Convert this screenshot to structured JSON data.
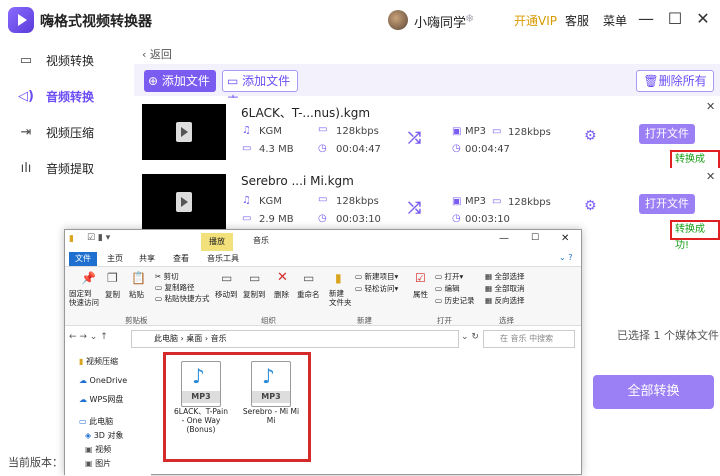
{
  "app": {
    "title": "嗨格式视频转换器",
    "username": "小嗨同学",
    "vip": "开通VIP",
    "service": "客服",
    "menu": "菜单"
  },
  "sidebar": {
    "items": [
      {
        "label": "视频转换",
        "icon": "film-icon"
      },
      {
        "label": "音频转换",
        "icon": "audio-icon"
      },
      {
        "label": "视频压缩",
        "icon": "compress-icon"
      },
      {
        "label": "音频提取",
        "icon": "waveform-icon"
      }
    ]
  },
  "toolbar": {
    "back": "返回",
    "add_file": "添加文件",
    "add_folder": "添加文件夹",
    "delete_all": "删除所有"
  },
  "files": [
    {
      "name": "6LACK、T-...nus).kgm",
      "src_format": "KGM",
      "src_bitrate": "128kbps",
      "src_size": "4.3 MB",
      "src_duration": "00:04:47",
      "dst_format": "MP3",
      "dst_bitrate": "128kbps",
      "dst_duration": "00:04:47",
      "open_label": "打开文件",
      "status": "转换成功!"
    },
    {
      "name": "Serebro ...i Mi.kgm",
      "src_format": "KGM",
      "src_bitrate": "128kbps",
      "src_size": "2.9 MB",
      "src_duration": "00:03:10",
      "dst_format": "MP3",
      "dst_bitrate": "128kbps",
      "dst_duration": "00:03:10",
      "open_label": "打开文件",
      "status": "转换成功!"
    }
  ],
  "footer": {
    "selected": "已选择 1 个媒体文件",
    "convert_all": "全部转换",
    "version": "当前版本：1"
  },
  "explorer": {
    "title": "音乐",
    "tabs": {
      "file": "文件",
      "home": "主页",
      "share": "共享",
      "view": "查看",
      "music_tools": "音乐工具",
      "play": "播放"
    },
    "ribbon": {
      "pin": "固定到\n快速访问",
      "copy": "复制",
      "paste": "粘贴",
      "cut": "剪切",
      "copy_path": "复制路径",
      "paste_shortcut": "粘贴快捷方式",
      "move_to": "移动到",
      "copy_to": "复制到",
      "delete": "删除",
      "rename": "重命名",
      "new_folder": "新建\n文件夹",
      "new_item": "新建项目",
      "easy_access": "轻松访问",
      "properties": "属性",
      "open": "打开",
      "edit": "编辑",
      "history": "历史记录",
      "select_all": "全部选择",
      "select_none": "全部取消",
      "invert": "反向选择",
      "g_clipboard": "剪贴板",
      "g_organize": "组织",
      "g_new": "新建",
      "g_open": "打开",
      "g_select": "选择"
    },
    "path": [
      "此电脑",
      "桌面",
      "音乐"
    ],
    "search_placeholder": "在 音乐 中搜索",
    "nav": [
      "视频压缩",
      "OneDrive",
      "WPS网盘",
      "此电脑",
      "3D 对象",
      "视频",
      "图片"
    ],
    "files": [
      {
        "name": "6LACK、T-Pain - One Way (Bonus)",
        "badge": "MP3"
      },
      {
        "name": "Serebro - Mi Mi Mi",
        "badge": "MP3"
      }
    ]
  }
}
